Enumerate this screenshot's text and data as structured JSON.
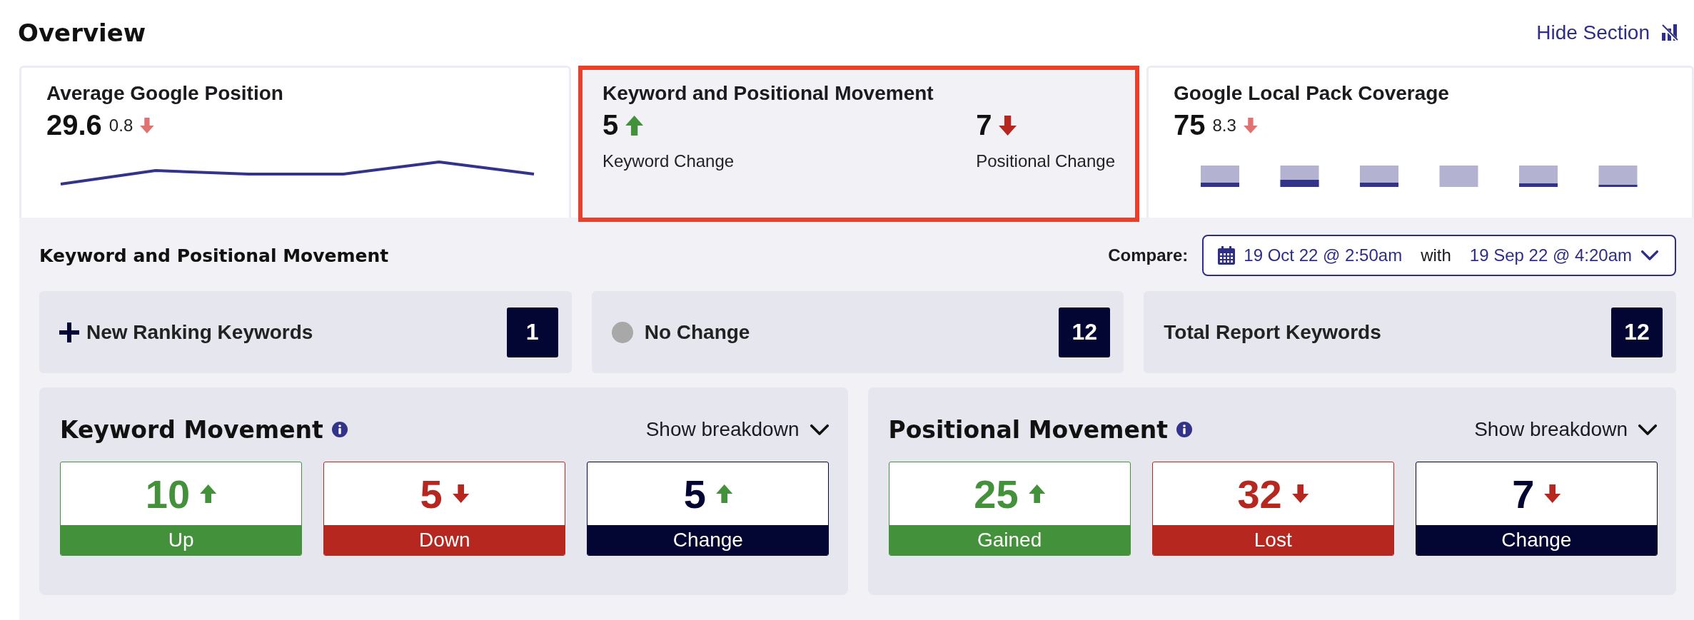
{
  "header": {
    "title": "Overview",
    "hide_link": "Hide Section"
  },
  "summary_cards": [
    {
      "kind": "sparkline",
      "title": "Average Google Position",
      "value": "29.6",
      "delta": "0.8",
      "rising": false,
      "selected": false
    },
    {
      "kind": "split",
      "title": "Keyword and Positional Movement",
      "selected": true,
      "metrics": [
        {
          "value": "5",
          "rising": true,
          "label": "Keyword Change"
        },
        {
          "value": "7",
          "rising": false,
          "label": "Positional Change"
        }
      ]
    },
    {
      "kind": "bars",
      "title": "Google Local Pack Coverage",
      "value": "75",
      "delta": "8.3",
      "rising": false,
      "selected": false
    }
  ],
  "movement": {
    "title": "Keyword and Positional Movement",
    "compare": {
      "label": "Compare:",
      "from": "19 Oct 22 @ 2:50am",
      "joiner": "with",
      "to": "19 Sep 22 @ 4:20am"
    },
    "stats": [
      {
        "kind": "plus",
        "label": "New Ranking Keywords",
        "count": "1"
      },
      {
        "kind": "dot",
        "label": "No Change",
        "count": "12"
      },
      {
        "kind": "plain",
        "label": "Total Report Keywords",
        "count": "12"
      }
    ],
    "panels": [
      {
        "title": "Keyword Movement",
        "toggle": "Show breakdown",
        "tiles": [
          {
            "kind": "gain",
            "value": "10",
            "rising": true,
            "label": "Up"
          },
          {
            "kind": "loss",
            "value": "5",
            "rising": false,
            "label": "Down"
          },
          {
            "kind": "net",
            "value": "5",
            "rising": true,
            "label": "Change"
          }
        ]
      },
      {
        "title": "Positional Movement",
        "toggle": "Show breakdown",
        "tiles": [
          {
            "kind": "gain",
            "value": "25",
            "rising": true,
            "label": "Gained"
          },
          {
            "kind": "loss",
            "value": "32",
            "rising": false,
            "label": "Lost"
          },
          {
            "kind": "net",
            "value": "7",
            "rising": false,
            "label": "Change"
          }
        ]
      }
    ]
  }
}
